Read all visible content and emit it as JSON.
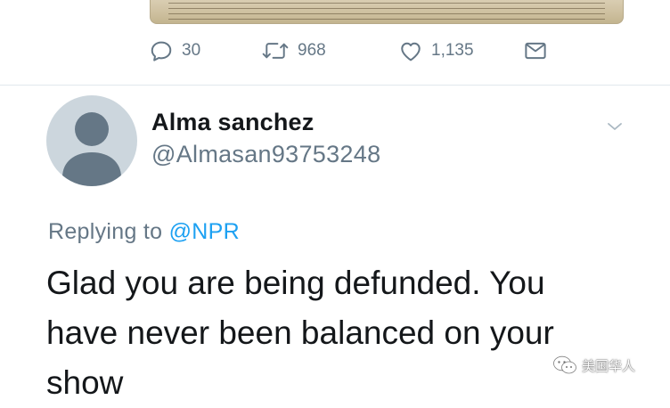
{
  "previous_tweet": {
    "actions": {
      "reply_count": "30",
      "retweet_count": "968",
      "like_count": "1,135"
    }
  },
  "reply_tweet": {
    "author_name": "Alma sanchez",
    "author_handle": "@Almasan93753248",
    "replying_to_prefix": "Replying to",
    "replying_to_mention": "@NPR",
    "lines": [
      "Glad you are being defunded. You",
      "have never been balanced on your",
      "show"
    ]
  },
  "watermark": {
    "text": "美国华人",
    "icon": "wechat-icon"
  },
  "colors": {
    "text_primary": "#14171a",
    "text_secondary": "#657786",
    "link": "#1da1f2",
    "divider": "#e1e8ed",
    "avatar_bg": "#ccd6dd"
  }
}
